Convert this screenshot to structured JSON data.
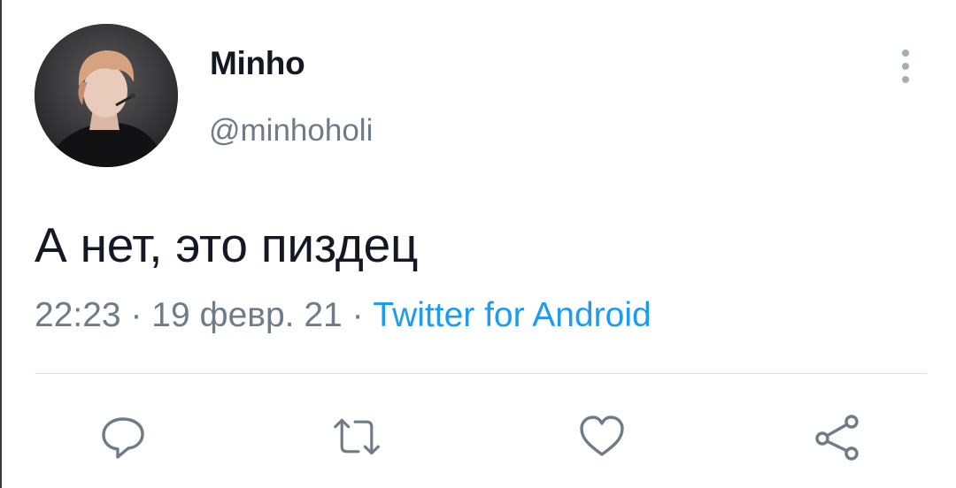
{
  "tweet": {
    "display_name": "Minho",
    "handle": "@minhoholi",
    "text": "А нет, это пиздец",
    "time": "22:23",
    "separator": "·",
    "date": "19 февр. 21",
    "source": "Twitter for Android"
  },
  "icons": {
    "more": "more-vertical-icon",
    "reply": "reply-icon",
    "retweet": "retweet-icon",
    "like": "heart-icon",
    "share": "share-icon"
  },
  "colors": {
    "text_primary": "#141823",
    "text_secondary": "#6f7b86",
    "link": "#1d9bf0",
    "icon": "#6f7b86"
  }
}
